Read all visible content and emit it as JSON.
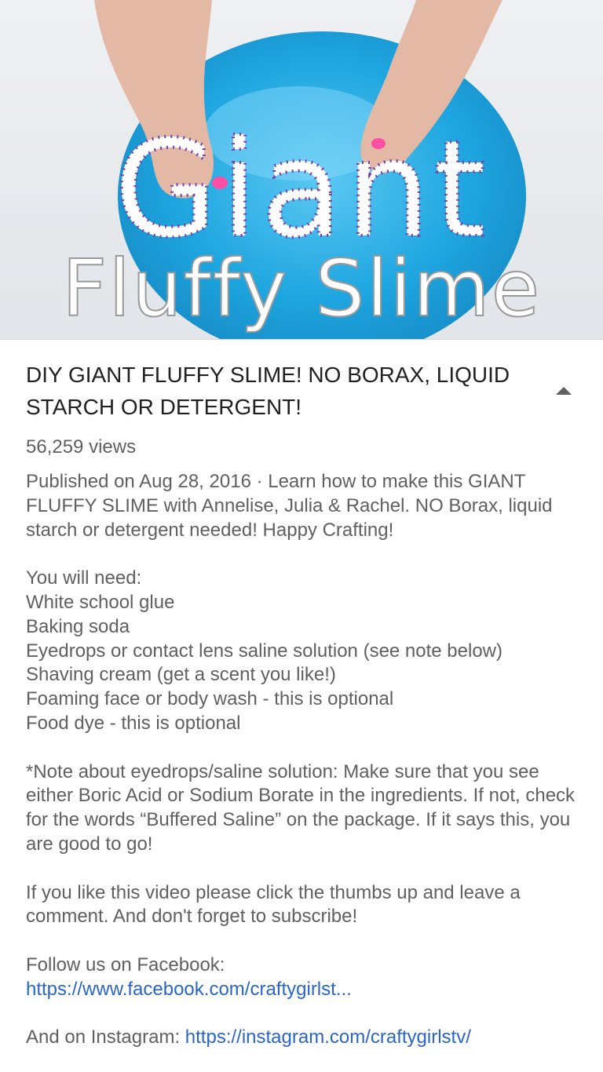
{
  "video": {
    "thumbnail_title_line1": "Giant",
    "thumbnail_title_line2": "Fluffy Slime",
    "title": "DIY GIANT FLUFFY SLIME!  NO BORAX, LIQUID STARCH OR DETERGENT!",
    "views": "56,259 views"
  },
  "description": {
    "published": "Published on Aug 28, 2016 · Learn how to make this GIANT FLUFFY SLIME with Annelise, Julia & Rachel.  NO Borax, liquid starch or detergent needed!  Happy Crafting!",
    "supplies_heading": "You will need:",
    "supplies": [
      "White school glue",
      "Baking soda",
      "Eyedrops or contact lens saline solution (see note below)",
      "Shaving cream (get a scent you like!)",
      "Foaming face or body wash - this is optional",
      "Food dye - this is optional"
    ],
    "note": "*Note about eyedrops/saline solution: Make sure that you see either Boric Acid or Sodium Borate in the ingredients.  If not, check for the words “Buffered Saline” on the package.  If it says this, you are good to go!",
    "cta": "If you like this video please click the thumbs up and leave a comment.  And don't forget to subscribe!",
    "facebook_label": "Follow us on Facebook:",
    "facebook_link": "https://www.facebook.com/craftygirlst...",
    "instagram_label": "And on Instagram: ",
    "instagram_link": "https://instagram.com/craftygirlstv/"
  },
  "colors": {
    "slime": "#1ea6e0",
    "link": "#2a66c9",
    "title_text": "#212121",
    "body_text": "#606060"
  },
  "icons": {
    "collapse": "chevron-up-icon"
  }
}
